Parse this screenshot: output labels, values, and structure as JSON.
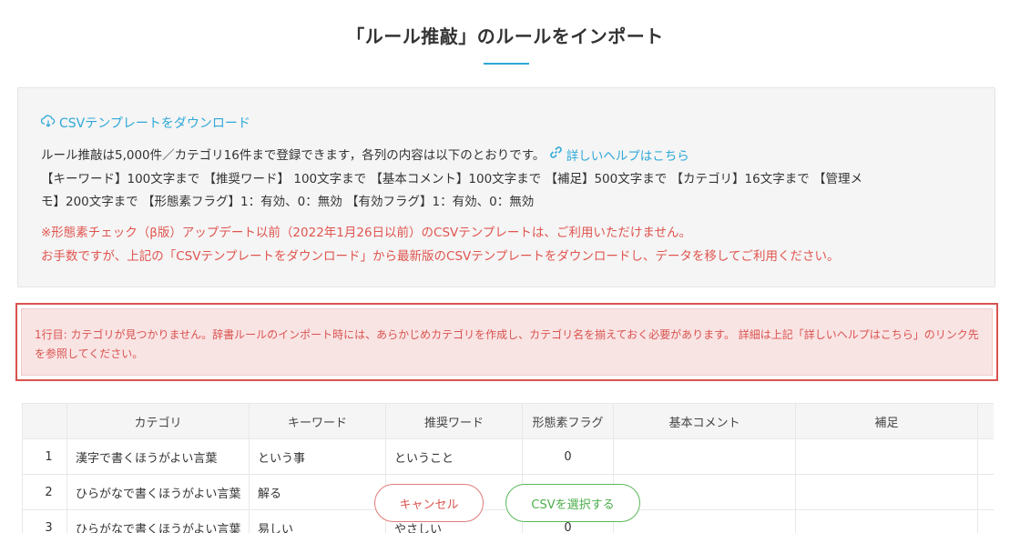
{
  "page": {
    "title": "「ルール推敲」のルールをインポート"
  },
  "info": {
    "download_label": "CSVテンプレートをダウンロード",
    "line1_text": "ルール推敲は5,000件／カテゴリ16件まで登録できます，各列の内容は以下のとおりです。",
    "help_link_label": "詳しいヘルプはこちら",
    "line2": "【キーワード】100文字まで 【推奨ワード】 100文字まで 【基本コメント】100文字まで 【補足】500文字まで 【カテゴリ】16文字まで 【管理メ",
    "line3": "モ】200文字まで 【形態素フラグ】1：有効、0：無効 【有効フラグ】1：有効、0：無効",
    "warning1": "※形態素チェック（β版）アップデート以前（2022年1月26日以前）のCSVテンプレートは、ご利用いただけません。",
    "warning2": "お手数ですが、上記の「CSVテンプレートをダウンロード」から最新版のCSVテンプレートをダウンロードし、データを移してご利用ください。"
  },
  "error": {
    "message": "1行目: カテゴリが見つかりません。辞書ルールのインポート時には、あらかじめカテゴリを作成し、カテゴリ名を揃えておく必要があります。 詳細は上記「詳しいヘルプはこちら」のリンク先を参照してください。"
  },
  "table": {
    "headers": [
      "",
      "カテゴリ",
      "キーワード",
      "推奨ワード",
      "形態素フラグ",
      "基本コメント",
      "補足",
      ""
    ],
    "rows": [
      [
        "1",
        "漢字で書くほうがよい言葉",
        "という事",
        "ということ",
        "0",
        "",
        "",
        ""
      ],
      [
        "2",
        "ひらがなで書くほうがよい言葉",
        "解る",
        "",
        "",
        "",
        "",
        ""
      ],
      [
        "3",
        "ひらがなで書くほうがよい言葉",
        "易しい",
        "やさしい",
        "0",
        "",
        "",
        ""
      ]
    ]
  },
  "buttons": {
    "cancel": "キャンセル",
    "select_csv": "CSVを選択する"
  },
  "colors": {
    "accent": "#2ea8d8",
    "error": "#d9534f",
    "success": "#5cb85c"
  }
}
